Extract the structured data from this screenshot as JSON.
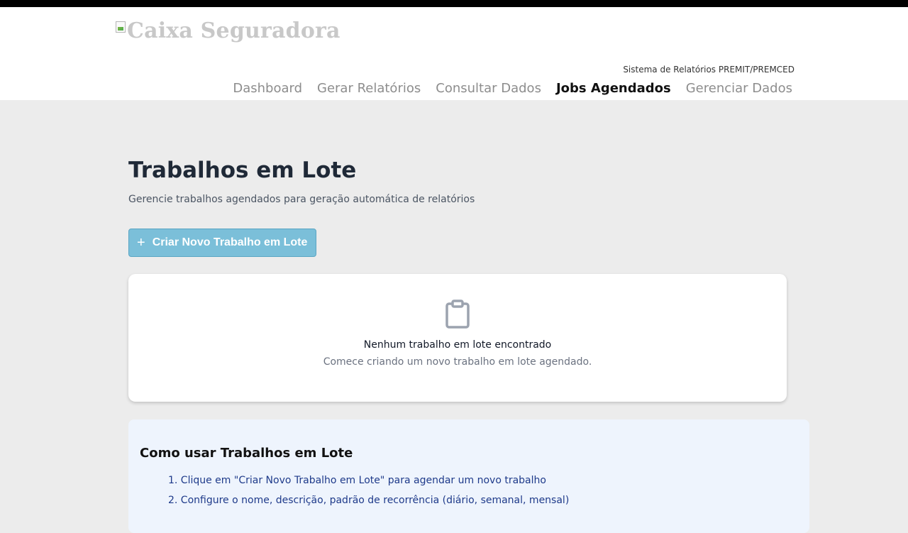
{
  "header": {
    "logo_alt": "Caixa Seguradora",
    "system_name": "Sistema de Relatórios PREMIT/PREMCED",
    "nav": [
      {
        "label": "Dashboard",
        "active": false
      },
      {
        "label": "Gerar Relatórios",
        "active": false
      },
      {
        "label": "Consultar Dados",
        "active": false
      },
      {
        "label": "Jobs Agendados",
        "active": true
      },
      {
        "label": "Gerenciar Dados",
        "active": false
      }
    ]
  },
  "main": {
    "title": "Trabalhos em Lote",
    "description": "Gerencie trabalhos agendados para geração automática de relatórios",
    "create_button": {
      "icon": "plus-icon",
      "label": "Criar Novo Trabalho em Lote"
    },
    "empty_state": {
      "icon": "clipboard-icon",
      "title": "Nenhum trabalho em lote encontrado",
      "subtitle": "Comece criando um novo trabalho em lote agendado."
    }
  },
  "help": {
    "title": "Como usar Trabalhos em Lote",
    "steps": [
      "1. Clique em \"Criar Novo Trabalho em Lote\" para agendar um novo trabalho",
      "2. Configure o nome, descrição, padrão de recorrência (diário, semanal, mensal)"
    ]
  },
  "colors": {
    "page_bg": "#ececec",
    "button_bg": "#7bbfd9",
    "help_bg": "#eef4fd",
    "help_text": "#1e3a8a"
  }
}
